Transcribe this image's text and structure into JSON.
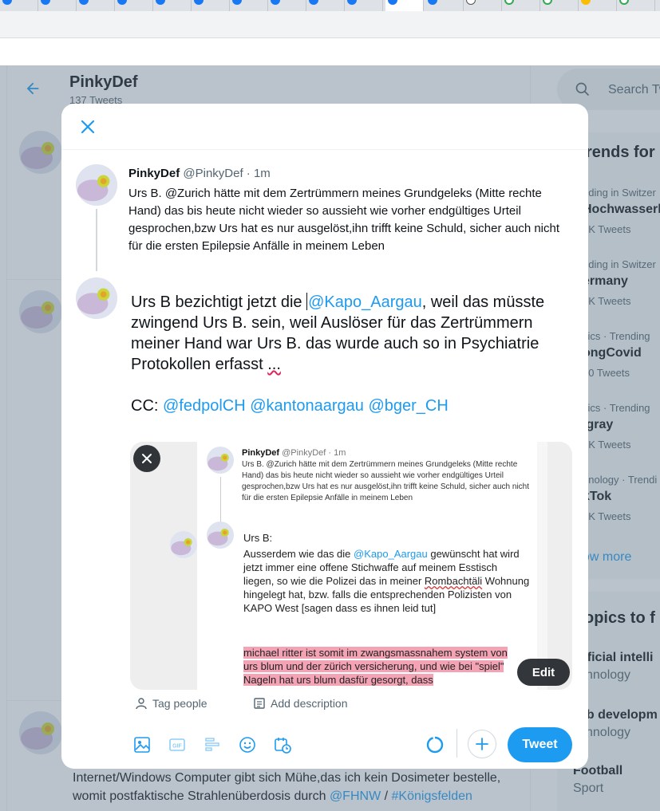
{
  "profile": {
    "name": "PinkyDef",
    "tweet_count": "137 Tweets"
  },
  "search": {
    "placeholder": "Search Tw"
  },
  "trends": {
    "title": "rends for",
    "items": [
      {
        "meta": "nding in Switzer",
        "name": "Hochwasserk",
        "count": "4K Tweets"
      },
      {
        "meta": "nding in Switzer",
        "name": "ermany",
        "count": "5K Tweets"
      },
      {
        "meta": "itics · Trending",
        "name": "ongCovid",
        "count": "80 Tweets"
      },
      {
        "meta": "itics · Trending",
        "name": "igray",
        "count": "4K Tweets"
      },
      {
        "meta": "hnology · Trendi",
        "name": "kTok",
        "count": "4K Tweets"
      }
    ],
    "show_more": "ow more"
  },
  "topics": {
    "title": "opics to f",
    "items": [
      {
        "name": "tificial intelli",
        "category": "chnology"
      },
      {
        "name": "eb developm",
        "category": "chnology"
      },
      {
        "name": "Football",
        "category": "Sport"
      }
    ]
  },
  "background_tweet": {
    "line1": "Internet/Windows Computer gibt sich Mühe,das ich kein Dosimeter bestelle,",
    "line2_pre": "womit postfaktische Strahlenüberdosis durch ",
    "line2_link1": "@FHNW",
    "line2_sep": " / ",
    "line2_link2": "#Königsfelden"
  },
  "reply_to": {
    "name": "PinkyDef",
    "handle": "@PinkyDef",
    "time": "1m",
    "text": "Urs B. @Zurich hätte mit dem Zertrümmern meines Grundgeleks (Mitte rechte Hand) das bis heute nicht wieder so aussieht wie vorher endgültiges Urteil gesprochen,bzw Urs hat es nur ausgelöst,ihn trifft keine Schuld, sicher auch nicht für die ersten Epilepsie Anfälle in meinem Leben"
  },
  "compose": {
    "p1_pre": "Urs B bezichtigt jetzt die ",
    "p1_mention": "@Kapo_Aargau",
    "p1_post": ", weil das müsste zwingend Urs B. sein, weil Auslöser für das Zertrümmern meiner Hand war Urs B. das wurde auch so in Psychiatrie Protokollen erfasst ",
    "p1_ellipsis": "...",
    "cc_label": "CC: ",
    "cc_1": "@fedpolCH",
    "cc_2": "@kantonaargau",
    "cc_3": "@bger_CH"
  },
  "attachment": {
    "head_name": "PinkyDef",
    "head_meta": " @PinkyDef · 1m",
    "reply_text": "Urs B. @Zurich hätte mit dem Zertrümmern meines Grundgeleks (Mitte rechte Hand) das bis heute nicht wieder so aussieht wie vorher endgültiges Urteil gesprochen,bzw Urs hat es nur ausgelöst,ihn trifft keine Schuld, sicher auch nicht für die ersten Epilepsie Anfälle in meinem Leben",
    "label": "Urs B:",
    "body_pre": "Ausserdem wie das die ",
    "body_mention": "@Kapo_Aargau",
    "body_mid": " gewünscht hat wird jetzt immer eine offene Stichwaffe auf meinem Esstisch liegen, so wie die Polizei das in meiner ",
    "body_ul": "Rombachtäli",
    "body_post": " Wohnung hingelegt hat, bzw. falls die entsprechenden Polizisten von KAPO West [sagen dass es ihnen leid tut]",
    "highlight": "michael ritter ist somit im zwangsmassnahem system von urs blum und der zürich versicherung, und wie bei \"spiel\" Nageln hat urs blum dasfür gesorgt, dass",
    "edit_label": "Edit"
  },
  "meta": {
    "tag_people": "Tag people",
    "add_description": "Add description"
  },
  "actions": {
    "tweet_label": "Tweet"
  },
  "progress": {
    "fraction": 0.05
  },
  "colors": {
    "accent": "#1d9bf0",
    "highlight": "#f4a3b4",
    "text": "#0f1419",
    "muted": "#536471"
  },
  "icons": [
    "close-icon",
    "back-arrow-icon",
    "search-icon",
    "image-icon",
    "gif-icon",
    "poll-icon",
    "emoji-icon",
    "schedule-icon",
    "person-icon",
    "description-icon",
    "plus-icon"
  ]
}
